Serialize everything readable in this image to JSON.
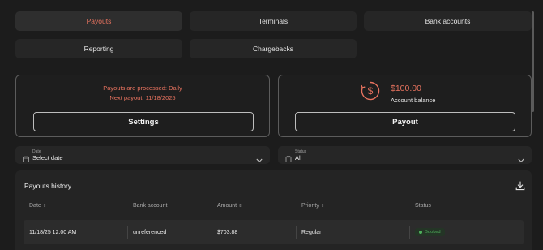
{
  "tabs": [
    {
      "label": "Payouts",
      "active": true
    },
    {
      "label": "Terminals",
      "active": false
    },
    {
      "label": "Bank accounts",
      "active": false
    },
    {
      "label": "Reporting",
      "active": false
    },
    {
      "label": "Chargebacks",
      "active": false
    }
  ],
  "schedule_card": {
    "line1": "Payouts are processed: Daily",
    "line2": "Next payout: 11/18/2025",
    "button": "Settings"
  },
  "balance_card": {
    "amount": "$100.00",
    "label": "Account balance",
    "icon": "dollar-circle-icon",
    "button": "Payout"
  },
  "filters": {
    "date": {
      "small_label": "Date",
      "value": "Select date",
      "icon": "calendar-icon"
    },
    "status": {
      "small_label": "Status",
      "value": "All",
      "icon": "clipboard-icon"
    }
  },
  "history": {
    "title": "Payouts history",
    "download_icon": "download-icon",
    "columns": [
      "Date",
      "Bank account",
      "Amount",
      "Priority",
      "Status"
    ],
    "sort_glyph": "⇕",
    "rows": [
      {
        "date": "11/18/25 12:00 AM",
        "bank_account": "unreferenced",
        "amount": "$703.88",
        "priority": "Regular",
        "status": "Booked"
      }
    ]
  },
  "colors": {
    "accent": "#e8735f",
    "status_booked": "#4fb05c",
    "background": "#1c1c1c"
  }
}
